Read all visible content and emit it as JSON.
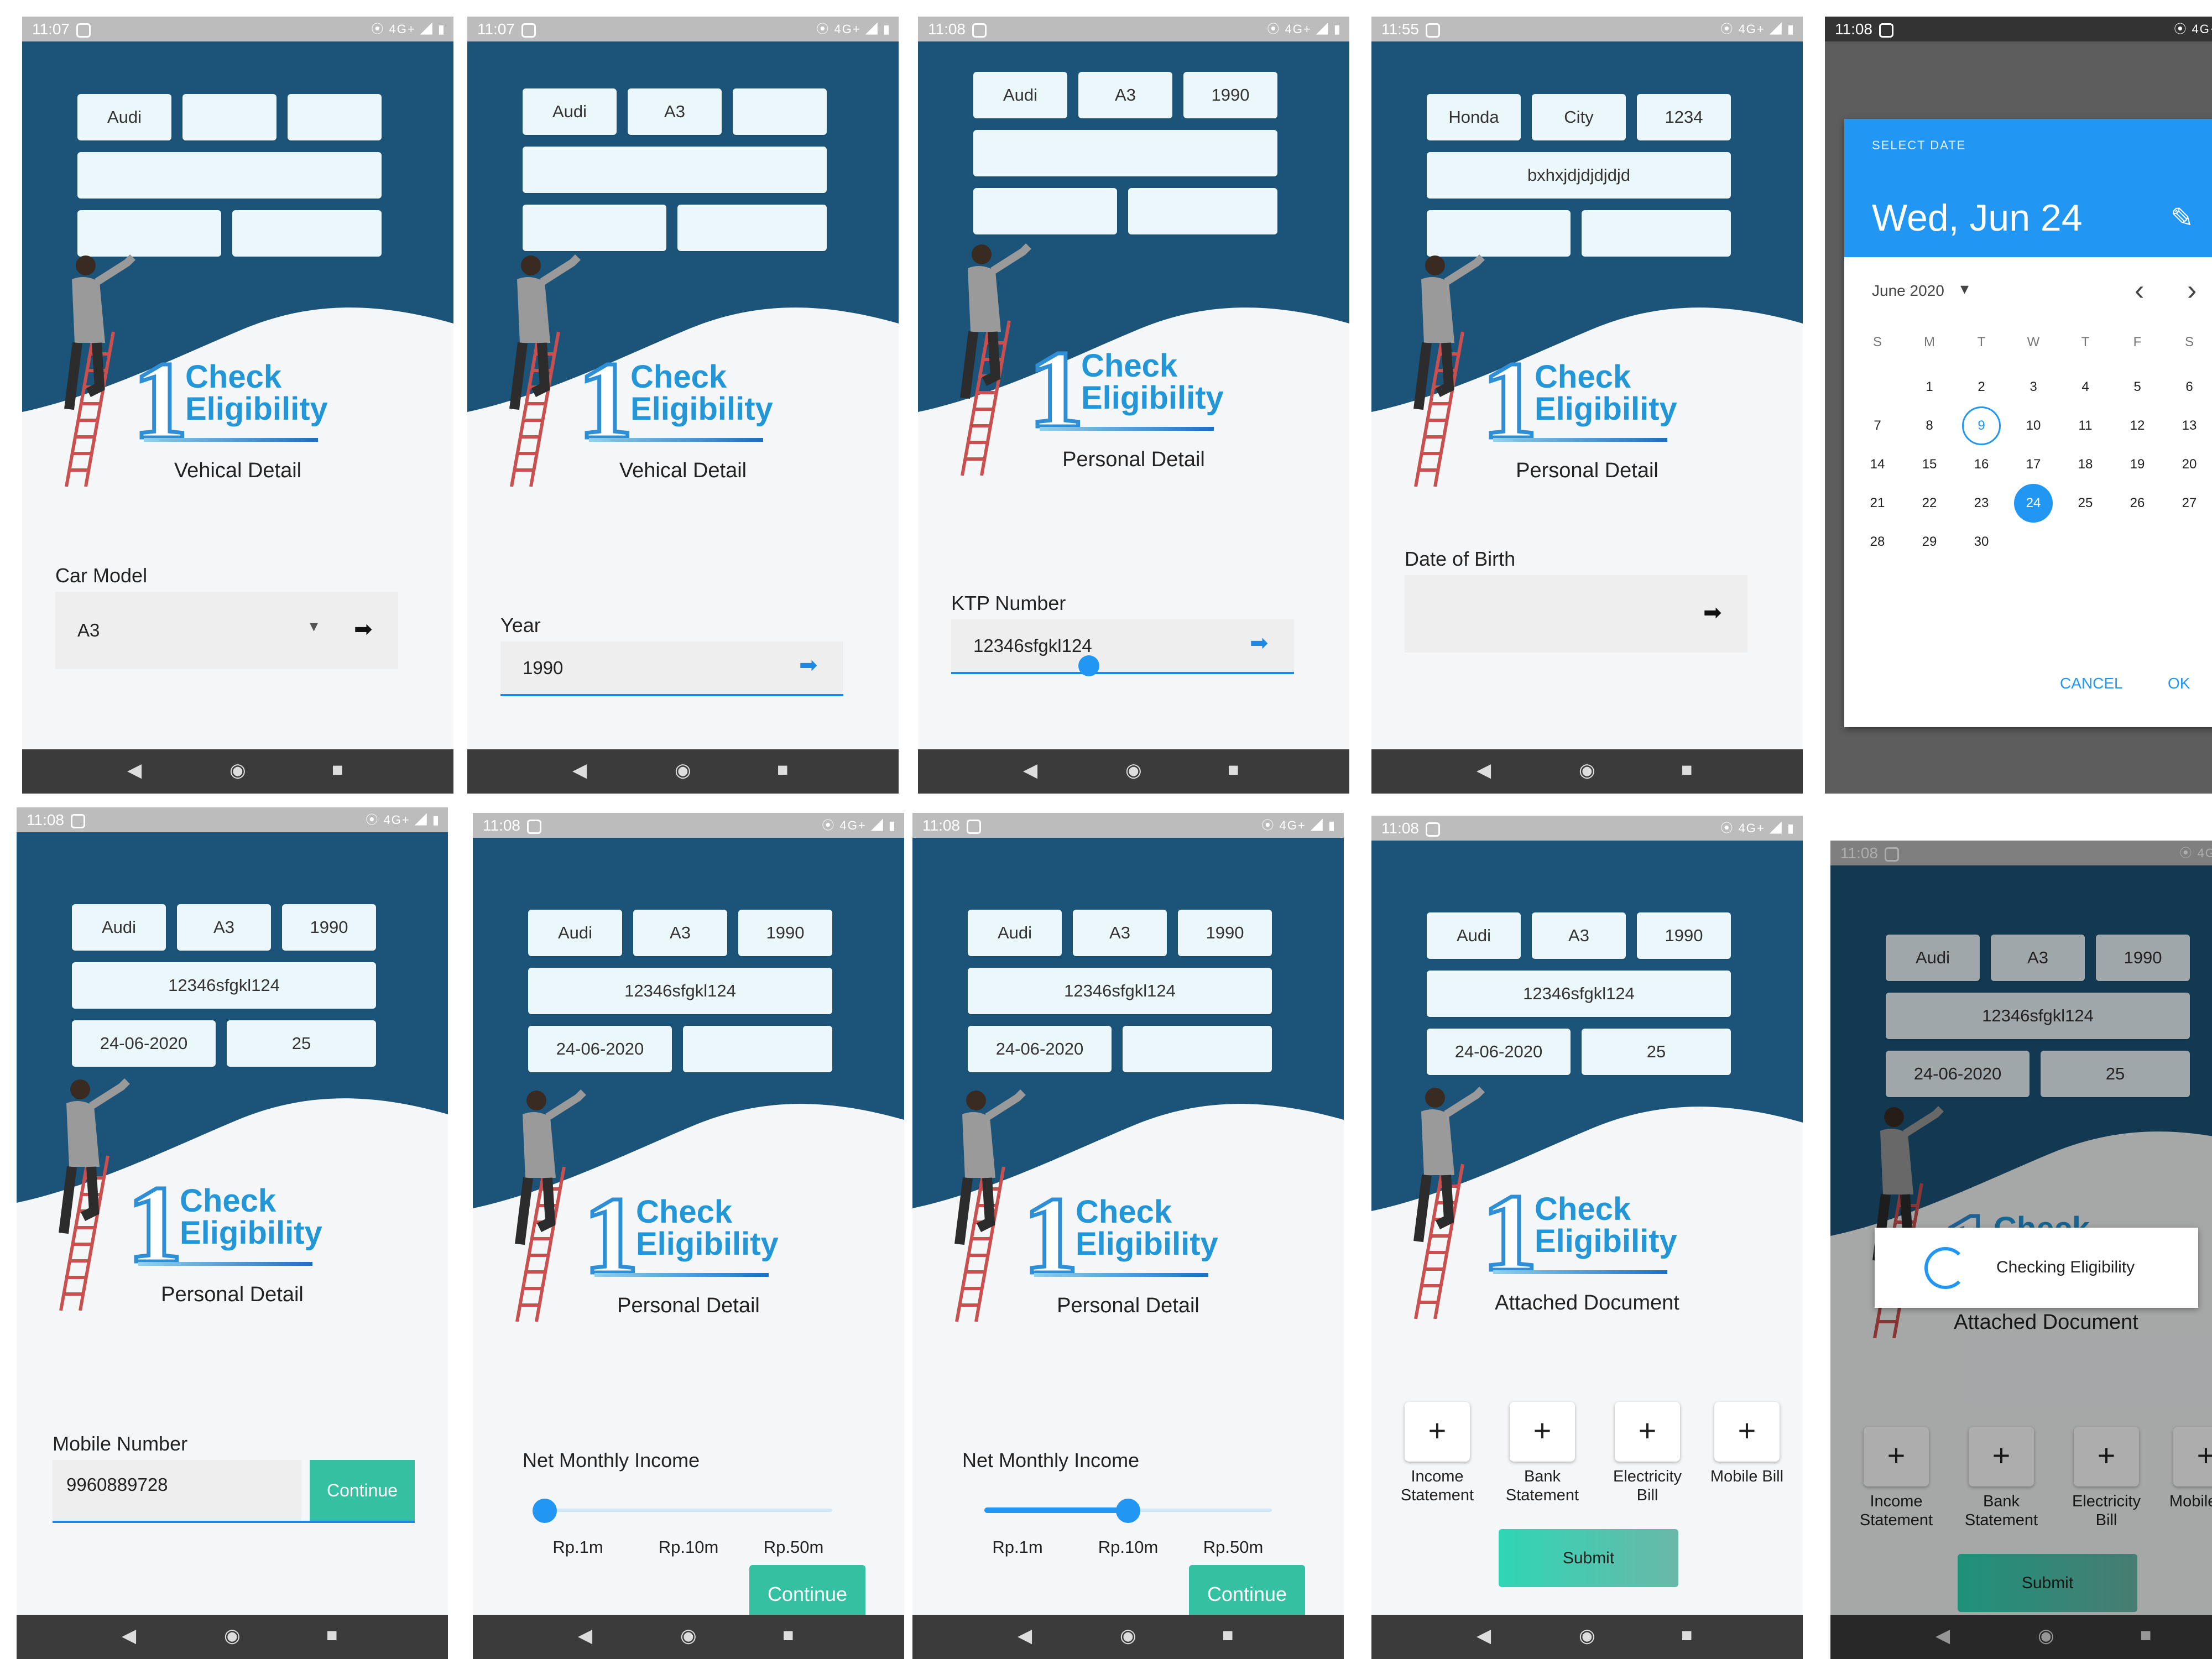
{
  "status_times": [
    "11:07",
    "11:07",
    "11:08",
    "11:55",
    "11:08",
    "11:08",
    "11:08",
    "11:08",
    "11:08",
    "11:08"
  ],
  "status_icons": "⦿ 4G+ ◢ ▮",
  "brand": {
    "digit": "1",
    "line1": "Check",
    "line2": "Eligibility"
  },
  "icons": {
    "next": "➡",
    "dropdown": "▾",
    "edit": "✎",
    "prev_month": "‹",
    "next_month": "›",
    "nav_back": "◀",
    "nav_home": "◉",
    "nav_recent": "■",
    "plus": "+"
  },
  "screens": {
    "s1": {
      "boxes": [
        "Audi",
        "",
        "",
        "",
        "",
        ""
      ],
      "section": "Vehical Detail",
      "field_label": "Car Model",
      "field_value": "A3"
    },
    "s2": {
      "boxes": [
        "Audi",
        "A3",
        "",
        "",
        "",
        ""
      ],
      "section": "Vehical Detail",
      "field_label": "Year",
      "field_value": "1990"
    },
    "s3": {
      "boxes": [
        "Audi",
        "A3",
        "1990",
        "",
        "",
        ""
      ],
      "section": "Personal Detail",
      "field_label": "KTP Number",
      "field_value": "12346sfgkl124"
    },
    "s4": {
      "boxes": [
        "Honda",
        "City",
        "1234",
        "bxhxjdjdjdjdjd",
        "",
        ""
      ],
      "section": "Personal Detail",
      "field_label": "Date of Birth",
      "field_value": ""
    },
    "s5": {
      "dialog_title": "SELECT DATE",
      "selected_date": "Wed, Jun 24",
      "month_label": "June 2020",
      "weekdays": [
        "S",
        "M",
        "T",
        "W",
        "T",
        "F",
        "S"
      ],
      "weeks": [
        [
          "",
          "1",
          "2",
          "3",
          "4",
          "5",
          "6"
        ],
        [
          "7",
          "8",
          "9",
          "10",
          "11",
          "12",
          "13"
        ],
        [
          "14",
          "15",
          "16",
          "17",
          "18",
          "19",
          "20"
        ],
        [
          "21",
          "22",
          "23",
          "24",
          "25",
          "26",
          "27"
        ],
        [
          "28",
          "29",
          "30",
          "",
          "",
          "",
          ""
        ]
      ],
      "today": "9",
      "selected": "24",
      "cancel": "CANCEL",
      "ok": "OK"
    },
    "s6": {
      "boxes": [
        "Audi",
        "A3",
        "1990",
        "12346sfgkl124",
        "24-06-2020",
        "25"
      ],
      "section": "Personal Detail",
      "field_label": "Mobile Number",
      "field_value": "9960889728",
      "button": "Continue"
    },
    "s7": {
      "boxes": [
        "Audi",
        "A3",
        "1990",
        "12346sfgkl124",
        "24-06-2020",
        ""
      ],
      "section": "Personal Detail",
      "field_label": "Net Monthly Income",
      "slider": {
        "labels": [
          "Rp.1m",
          "Rp.10m",
          "Rp.50m"
        ],
        "position": 0.0
      },
      "button": "Continue"
    },
    "s8": {
      "boxes": [
        "Audi",
        "A3",
        "1990",
        "12346sfgkl124",
        "24-06-2020",
        ""
      ],
      "section": "Personal Detail",
      "field_label": "Net Monthly Income",
      "slider": {
        "labels": [
          "Rp.1m",
          "Rp.10m",
          "Rp.50m"
        ],
        "position": 0.5
      },
      "button": "Continue"
    },
    "s9": {
      "boxes": [
        "Audi",
        "A3",
        "1990",
        "12346sfgkl124",
        "24-06-2020",
        "25"
      ],
      "section": "Attached Document",
      "docs": [
        "Income Statement",
        "Bank Statement",
        "Electricity Bill",
        "Mobile Bill"
      ],
      "button": "Submit"
    },
    "s10": {
      "boxes": [
        "Audi",
        "A3",
        "1990",
        "12346sfgkl124",
        "24-06-2020",
        "25"
      ],
      "section": "Attached Document",
      "docs": [
        "Income Statement",
        "Bank Statement",
        "Electricity Bill",
        "Mobile Bill"
      ],
      "button": "Submit",
      "loading_text": "Checking Eligibility"
    }
  },
  "colors": {
    "header_dark": "#1b5478",
    "accent_blue": "#2196f3",
    "teal": "#33c1a2",
    "box_bg": "#ecf7fb"
  }
}
